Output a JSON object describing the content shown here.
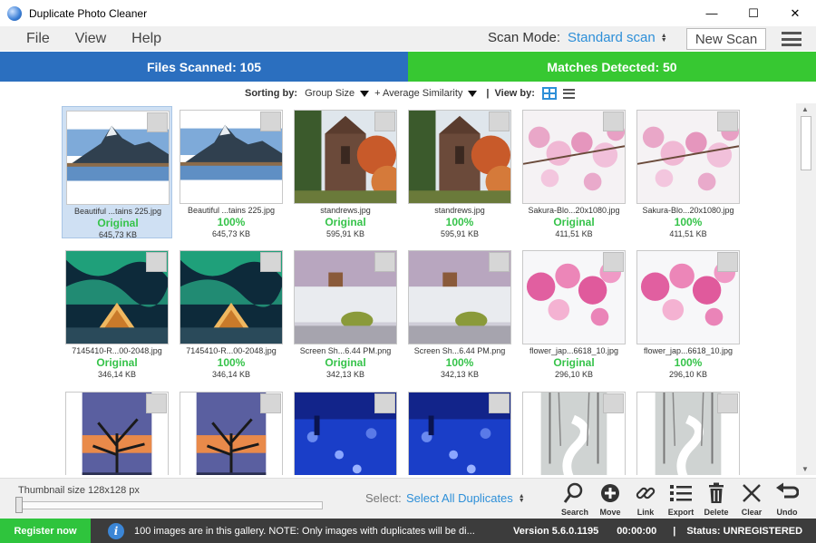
{
  "window": {
    "title": "Duplicate Photo Cleaner",
    "minimize": "—",
    "maximize": "☐",
    "close": "✕"
  },
  "menu": {
    "file": "File",
    "view": "View",
    "help": "Help",
    "scan_mode_label": "Scan Mode:",
    "scan_mode_value": "Standard scan",
    "new_scan": "New Scan"
  },
  "stats": {
    "files_scanned": "Files Scanned: 105",
    "matches_detected": "Matches Detected: 50"
  },
  "sortbar": {
    "sorting_label": "Sorting by:",
    "sort_primary": "Group Size",
    "sort_secondary": "+ Average Similarity",
    "view_label": "View by:"
  },
  "gallery": {
    "rows": [
      [
        {
          "name": "Beautiful ...tains 225.jpg",
          "tag": "Original",
          "size": "645,73 KB",
          "image": "mountain-lake",
          "selected": true
        },
        {
          "name": "Beautiful ...tains 225.jpg",
          "tag": "100%",
          "size": "645,73 KB",
          "image": "mountain-lake"
        },
        {
          "name": "standrews.jpg",
          "tag": "Original",
          "size": "595,91 KB",
          "image": "cathedral"
        },
        {
          "name": "standrews.jpg",
          "tag": "100%",
          "size": "595,91 KB",
          "image": "cathedral"
        },
        {
          "name": "Sakura-Blo...20x1080.jpg",
          "tag": "Original",
          "size": "411,51 KB",
          "image": "sakura"
        },
        {
          "name": "Sakura-Blo...20x1080.jpg",
          "tag": "100%",
          "size": "411,51 KB",
          "image": "sakura"
        }
      ],
      [
        {
          "name": "7145410-R...00-2048.jpg",
          "tag": "Original",
          "size": "346,14 KB",
          "image": "aurora"
        },
        {
          "name": "7145410-R...00-2048.jpg",
          "tag": "100%",
          "size": "346,14 KB",
          "image": "aurora"
        },
        {
          "name": "Screen Sh...6.44 PM.png",
          "tag": "Original",
          "size": "342,13 KB",
          "image": "beach"
        },
        {
          "name": "Screen Sh...6.44 PM.png",
          "tag": "100%",
          "size": "342,13 KB",
          "image": "beach"
        },
        {
          "name": "flower_jap...6618_10.jpg",
          "tag": "Original",
          "size": "296,10 KB",
          "image": "cherry"
        },
        {
          "name": "flower_jap...6618_10.jpg",
          "tag": "100%",
          "size": "296,10 KB",
          "image": "cherry"
        }
      ],
      [
        {
          "name": "",
          "tag": "",
          "size": "",
          "image": "tree-sunset"
        },
        {
          "name": "",
          "tag": "",
          "size": "",
          "image": "tree-sunset"
        },
        {
          "name": "",
          "tag": "",
          "size": "",
          "image": "blue-lights"
        },
        {
          "name": "",
          "tag": "",
          "size": "",
          "image": "blue-lights"
        },
        {
          "name": "",
          "tag": "",
          "size": "",
          "image": "snow-path"
        },
        {
          "name": "",
          "tag": "",
          "size": "",
          "image": "snow-path"
        }
      ]
    ]
  },
  "bottom": {
    "thumb_size_label": "Thumbnail size 128x128 px",
    "thumb_size_level": 0,
    "select_label": "Select:",
    "select_value": "Select All Duplicates",
    "tools": [
      {
        "key": "search",
        "label": "Search",
        "icon": "magnifier-icon"
      },
      {
        "key": "move",
        "label": "Move",
        "icon": "plus-circle-icon"
      },
      {
        "key": "link",
        "label": "Link",
        "icon": "link-icon"
      },
      {
        "key": "export",
        "label": "Export",
        "icon": "export-list-icon"
      },
      {
        "key": "delete",
        "label": "Delete",
        "icon": "trash-icon"
      },
      {
        "key": "clear",
        "label": "Clear",
        "icon": "x-icon"
      },
      {
        "key": "undo",
        "label": "Undo",
        "icon": "undo-icon"
      }
    ]
  },
  "status": {
    "register": "Register now",
    "message": "100 images are in this gallery. NOTE: Only images with duplicates will be di...",
    "version": "Version 5.6.0.1195",
    "time": "00:00:00",
    "pipe": "|",
    "registration": "Status: UNREGISTERED"
  },
  "colors": {
    "accent_blue": "#2d8fd8",
    "files_bar": "#2b6fbf",
    "matches_bar": "#37c832",
    "tag_green": "#36c34a"
  }
}
